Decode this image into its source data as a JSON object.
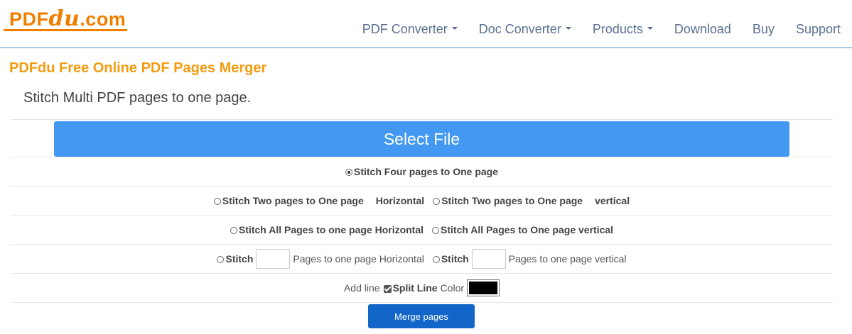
{
  "logo": {
    "pdf": "PDF",
    "du": "du",
    "com": ".com"
  },
  "nav": [
    {
      "label": "PDF Converter",
      "dropdown": true
    },
    {
      "label": "Doc Converter",
      "dropdown": true
    },
    {
      "label": "Products",
      "dropdown": true
    },
    {
      "label": "Download",
      "dropdown": false
    },
    {
      "label": "Buy",
      "dropdown": false
    },
    {
      "label": "Support",
      "dropdown": false
    }
  ],
  "page": {
    "title": "PDFdu Free Online PDF Pages Merger",
    "subtitle": "Stitch Multi PDF pages to one page."
  },
  "select_button": "Select File",
  "options": {
    "four": "Stitch Four pages to One page",
    "two_h": "Stitch Two pages to One page",
    "two_h_suffix": "Horizontal",
    "two_v": "Stitch Two pages to One page",
    "two_v_suffix": "vertical",
    "all_h": "Stitch All Pages to one page Horizontal",
    "all_v": "Stitch All Pages to One page vertical",
    "n_h_prefix": "Stitch",
    "n_h_suffix": "Pages to one page Horizontal",
    "n_v_prefix": "Stitch",
    "n_v_suffix": "Pages to one page vertical"
  },
  "line": {
    "add": "Add line",
    "split": "Split Line",
    "color": "Color",
    "color_value": "#000000"
  },
  "merge_button": "Merge pages",
  "colors": {
    "brand": "#f07f00",
    "title": "#f39c12",
    "select_btn": "#4399f2",
    "merge_btn": "#1266c8",
    "nav": "#5a7090"
  }
}
